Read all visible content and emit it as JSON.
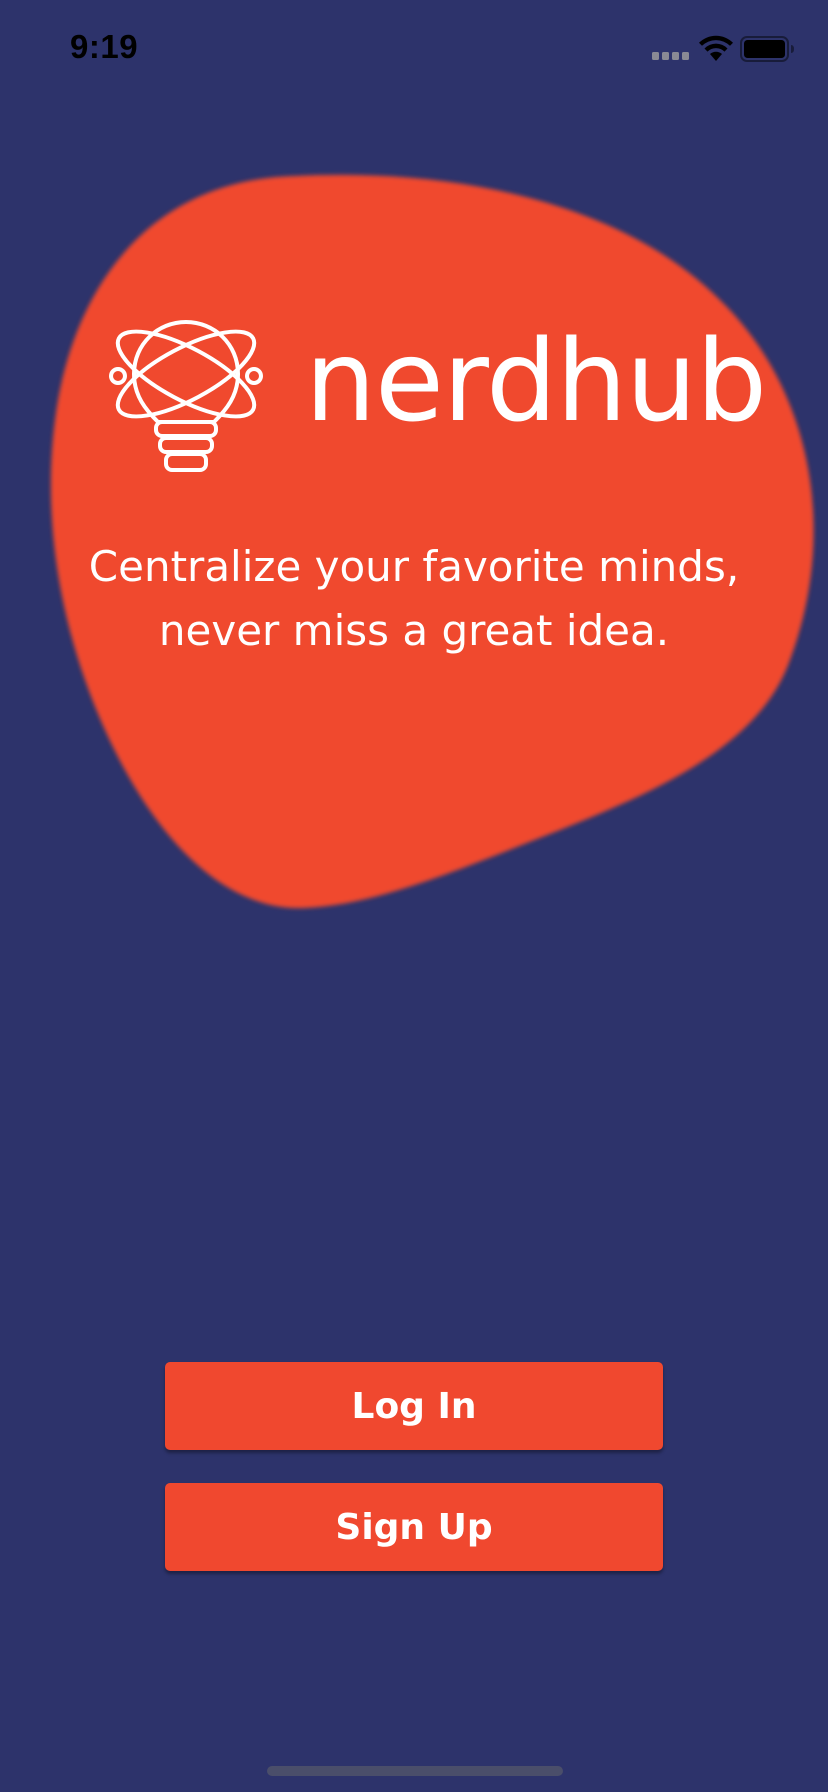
{
  "colors": {
    "background": "#2d336b",
    "accent": "#f0482f",
    "text_light": "#ffffff",
    "status_text": "#000000",
    "home_indicator": "#4a4e6a"
  },
  "status_bar": {
    "time": "9:19",
    "icons": [
      "cellular-signal-icon",
      "wifi-icon",
      "battery-icon"
    ]
  },
  "brand": {
    "logo_icon": "lightbulb-atom-icon",
    "name": "nerdhub"
  },
  "tagline": "Centralize your favorite minds,\nnever miss a great idea.",
  "actions": {
    "login_label": "Log In",
    "signup_label": "Sign Up"
  }
}
